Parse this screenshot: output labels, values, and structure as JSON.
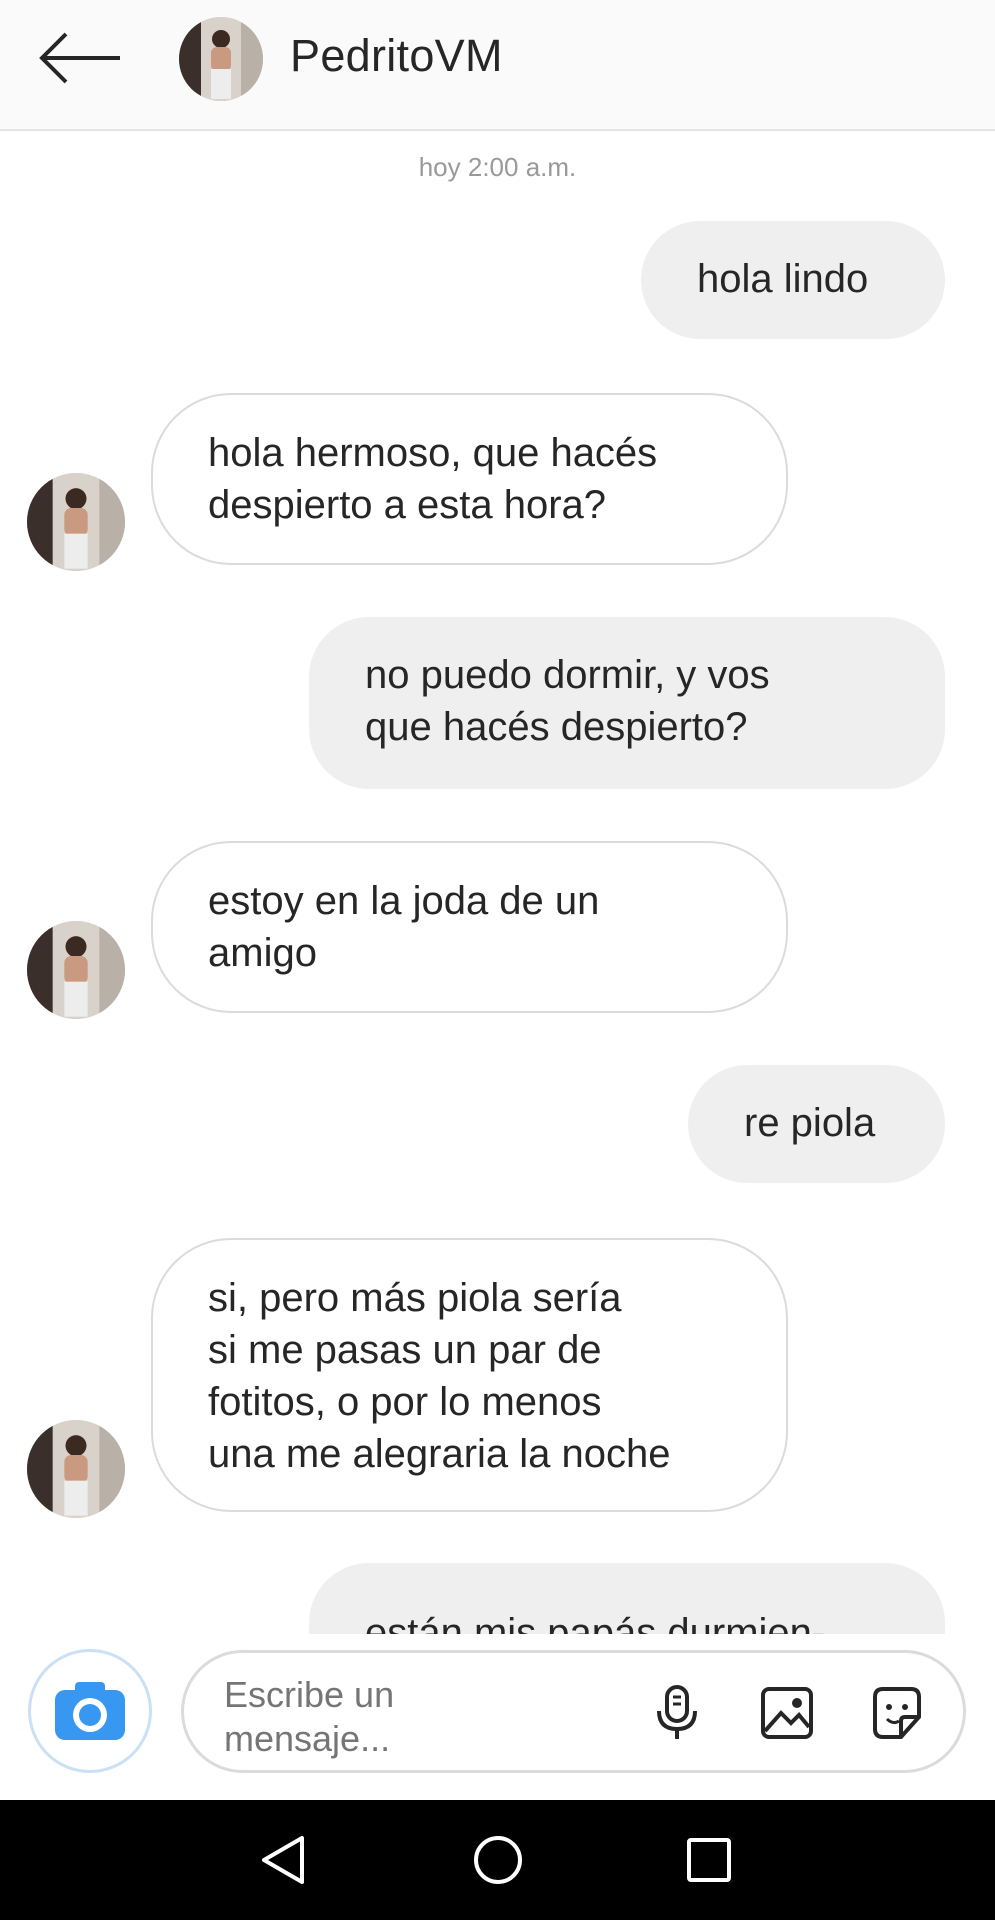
{
  "header": {
    "contact_name": "PedritoVM",
    "back_icon": "arrow-left-icon",
    "avatar": "contact-avatar"
  },
  "chat": {
    "timestamp": "hoy 2:00 a.m.",
    "messages": [
      {
        "direction": "outgoing",
        "text": "hola lindo"
      },
      {
        "direction": "incoming",
        "text": "hola hermoso, que hacés\ndespierto a esta hora?"
      },
      {
        "direction": "outgoing",
        "text": "no puedo dormir, y vos\nque hacés despierto?"
      },
      {
        "direction": "incoming",
        "text": "estoy en la joda de un\namigo"
      },
      {
        "direction": "outgoing",
        "text": "re piola"
      },
      {
        "direction": "incoming",
        "text": "si, pero más piola sería\nsi me pasas un par de\nfotitos, o por lo menos\nuna me alegraria la noche"
      },
      {
        "direction": "outgoing",
        "text": "están mis papás durmien-"
      }
    ]
  },
  "composer": {
    "placeholder": "Escribe un\nmensaje...",
    "icons": [
      "camera-icon",
      "microphone-icon",
      "gallery-icon",
      "sticker-icon"
    ],
    "camera_color": "#3897f0"
  },
  "navbar": {
    "icons": [
      "back-triangle-icon",
      "home-circle-icon",
      "recents-square-icon"
    ]
  }
}
